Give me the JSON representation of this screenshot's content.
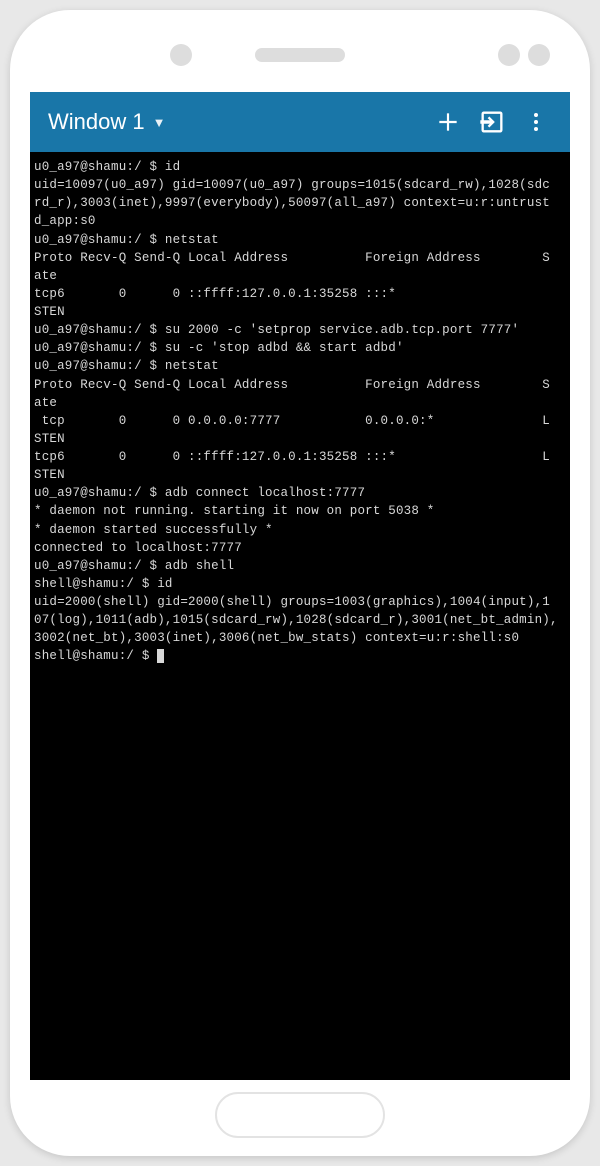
{
  "toolbar": {
    "window_label": "Window 1"
  },
  "terminal": {
    "lines": [
      "u0_a97@shamu:/ $ id",
      "uid=10097(u0_a97) gid=10097(u0_a97) groups=1015(sdcard_rw),1028(sdc",
      "rd_r),3003(inet),9997(everybody),50097(all_a97) context=u:r:untrust",
      "d_app:s0",
      "u0_a97@shamu:/ $ netstat",
      "Proto Recv-Q Send-Q Local Address          Foreign Address        S",
      "ate",
      "tcp6       0      0 ::ffff:127.0.0.1:35258 :::*",
      "STEN",
      "u0_a97@shamu:/ $ su 2000 -c 'setprop service.adb.tcp.port 7777'",
      "u0_a97@shamu:/ $ su -c 'stop adbd && start adbd'",
      "u0_a97@shamu:/ $ netstat",
      "Proto Recv-Q Send-Q Local Address          Foreign Address        S",
      "ate",
      " tcp       0      0 0.0.0.0:7777           0.0.0.0:*              L",
      "STEN",
      "tcp6       0      0 ::ffff:127.0.0.1:35258 :::*                   L",
      "STEN",
      "u0_a97@shamu:/ $ adb connect localhost:7777",
      "* daemon not running. starting it now on port 5038 *",
      "* daemon started successfully *",
      "connected to localhost:7777",
      "u0_a97@shamu:/ $ adb shell",
      "shell@shamu:/ $ id",
      "uid=2000(shell) gid=2000(shell) groups=1003(graphics),1004(input),1",
      "07(log),1011(adb),1015(sdcard_rw),1028(sdcard_r),3001(net_bt_admin),",
      "3002(net_bt),3003(inet),3006(net_bw_stats) context=u:r:shell:s0",
      "shell@shamu:/ $ "
    ]
  }
}
